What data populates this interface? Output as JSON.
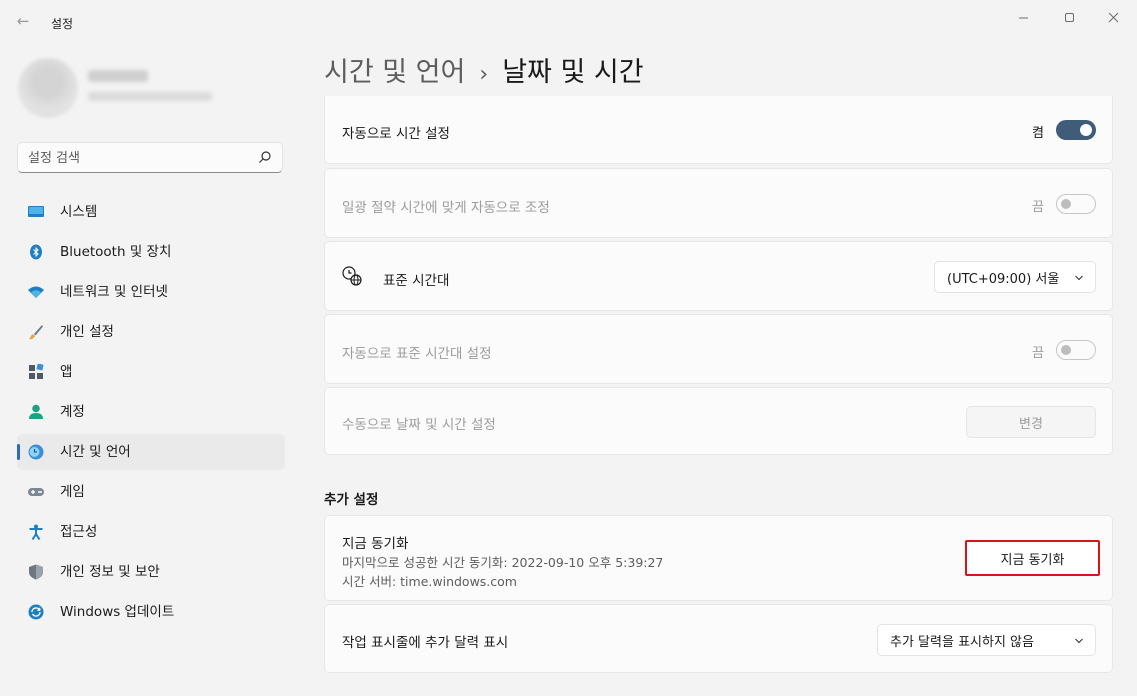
{
  "window": {
    "title": "설정",
    "back_icon": "arrow-left-icon",
    "controls": [
      "minimize-icon",
      "maximize-icon",
      "close-icon"
    ]
  },
  "search": {
    "placeholder": "설정 검색",
    "icon": "search-icon"
  },
  "sidebar": {
    "items": [
      {
        "label": "시스템",
        "icon": "monitor-icon",
        "active": false
      },
      {
        "label": "Bluetooth 및 장치",
        "icon": "bluetooth-icon",
        "active": false
      },
      {
        "label": "네트워크 및 인터넷",
        "icon": "wifi-icon",
        "active": false
      },
      {
        "label": "개인 설정",
        "icon": "paintbrush-icon",
        "active": false
      },
      {
        "label": "앱",
        "icon": "apps-icon",
        "active": false
      },
      {
        "label": "계정",
        "icon": "person-icon",
        "active": false
      },
      {
        "label": "시간 및 언어",
        "icon": "clock-globe-icon",
        "active": true
      },
      {
        "label": "게임",
        "icon": "gamepad-icon",
        "active": false
      },
      {
        "label": "접근성",
        "icon": "accessibility-icon",
        "active": false
      },
      {
        "label": "개인 정보 및 보안",
        "icon": "shield-icon",
        "active": false
      },
      {
        "label": "Windows 업데이트",
        "icon": "update-icon",
        "active": false
      }
    ]
  },
  "breadcrumb": {
    "parent": "시간 및 언어",
    "separator": "›",
    "current": "날짜 및 시간"
  },
  "settings": {
    "auto_time": {
      "label": "자동으로 시간 설정",
      "state": "켬",
      "on": true
    },
    "auto_dst": {
      "label": "일광 절약 시간에 맞게 자동으로 조정",
      "state": "끔",
      "on": false,
      "disabled": true
    },
    "timezone": {
      "label": "표준 시간대",
      "value": "(UTC+09:00) 서울",
      "icon": "clock-globe-icon"
    },
    "auto_timezone": {
      "label": "자동으로 표준 시간대 설정",
      "state": "끔",
      "on": false,
      "disabled": true
    },
    "manual_time": {
      "label": "수동으로 날짜 및 시간 설정",
      "button": "변경",
      "disabled": true
    }
  },
  "additional": {
    "title": "추가 설정",
    "sync": {
      "title": "지금 동기화",
      "last_sync": "마지막으로 성공한 시간 동기화: 2022-09-10 오후 5:39:27",
      "server": "시간 서버: time.windows.com",
      "button": "지금 동기화"
    },
    "calendar": {
      "label": "작업 표시줄에 추가 달력 표시",
      "value": "추가 달력을 표시하지 않음"
    }
  },
  "colors": {
    "accent": "#2a6db2",
    "toggle_on": "#3f5d78",
    "highlight_border": "#d9131a"
  }
}
